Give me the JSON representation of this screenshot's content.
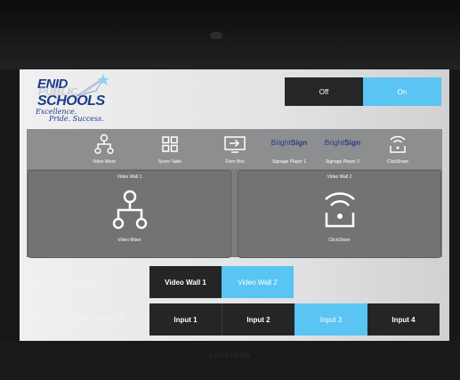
{
  "bezel": {
    "brand": "CRESTRON"
  },
  "logo": {
    "line1": "ENID",
    "line2": "PUBLIC",
    "line3": "SCHOOLS",
    "tagline1": "Excellence.",
    "tagline2": "Pride. Success."
  },
  "power": {
    "off_label": "Off",
    "on_label": "On",
    "selected": "On"
  },
  "sources": [
    {
      "label": "Video Mixer",
      "icon": "network-icon"
    },
    {
      "label": "Score Table",
      "icon": "grid-icon"
    },
    {
      "label": "Floor Box",
      "icon": "input-icon"
    },
    {
      "label": "Signage Player 1",
      "icon": "brightsign-logo",
      "brand_a": "Bright",
      "brand_b": "Sign"
    },
    {
      "label": "Signage Player 2",
      "icon": "brightsign-logo",
      "brand_a": "Bright",
      "brand_b": "Sign"
    },
    {
      "label": "ClickShare",
      "icon": "clickshare-icon"
    }
  ],
  "walls": [
    {
      "title": "Video Wall 1",
      "source": "Video Mixer",
      "icon": "network-icon"
    },
    {
      "title": "Video Wall 2",
      "source": "ClickShare",
      "icon": "clickshare-icon"
    }
  ],
  "audio_source": {
    "label": "Audio Source",
    "options": [
      "Video Wall 1",
      "Video Wall 2"
    ],
    "selected": "Video Wall 2"
  },
  "video_mixer_source": {
    "label": "Video Mixer Source",
    "options": [
      "Input 1",
      "Input 2",
      "Input 3",
      "Input 4"
    ],
    "selected": "Input 3"
  },
  "colors": {
    "accent": "#5ac4f3",
    "dark_button": "#252526",
    "logo_blue": "#1b3a8a"
  }
}
